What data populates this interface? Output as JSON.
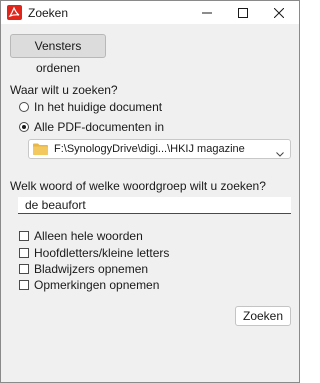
{
  "window": {
    "title": "Zoeken",
    "brand_color": "#e1251b"
  },
  "toolbar": {
    "arrange_windows_label": "Vensters ordenen"
  },
  "scope": {
    "question": "Waar wilt u zoeken?",
    "options": [
      {
        "label": "In het huidige document",
        "selected": false
      },
      {
        "label": "Alle PDF-documenten in",
        "selected": true
      }
    ],
    "folder_select": {
      "value": "F:\\SynologyDrive\\digi...\\HKIJ magazine",
      "icon": "folder-icon"
    }
  },
  "search": {
    "question": "Welk woord of welke woordgroep wilt u zoeken?",
    "value": "de beaufort"
  },
  "options": [
    {
      "label": "Alleen hele woorden",
      "checked": false
    },
    {
      "label": "Hoofdletters/kleine letters",
      "checked": false
    },
    {
      "label": "Bladwijzers opnemen",
      "checked": false
    },
    {
      "label": "Opmerkingen opnemen",
      "checked": false
    }
  ],
  "actions": {
    "search_label": "Zoeken"
  }
}
